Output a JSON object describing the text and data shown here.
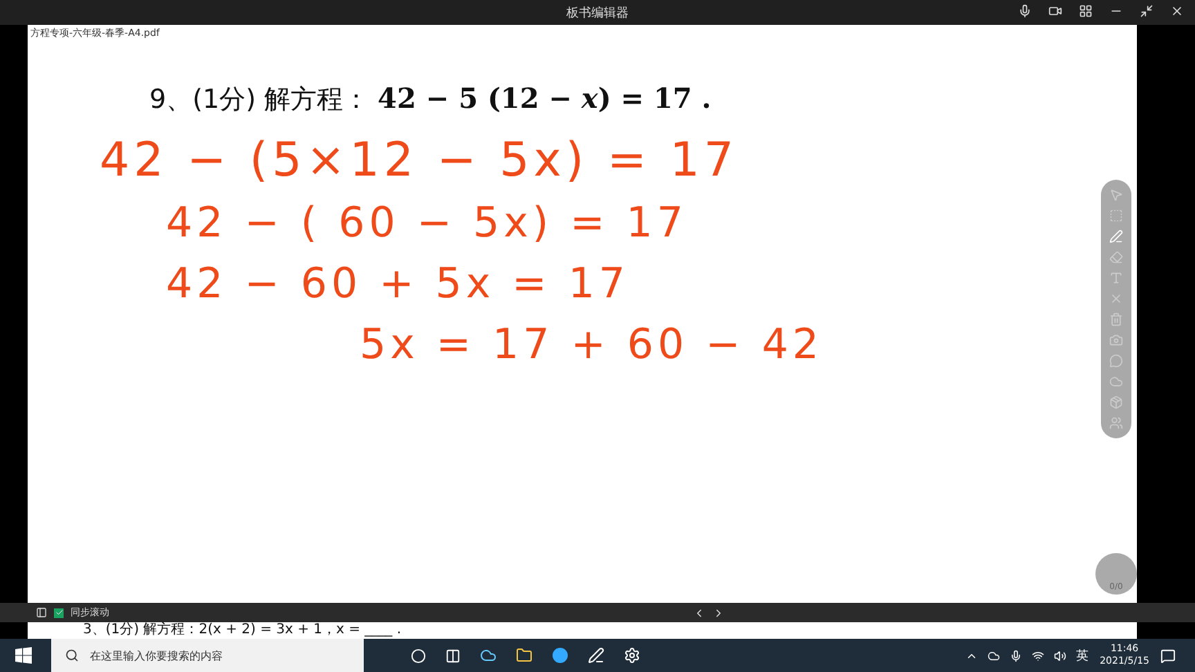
{
  "window": {
    "title": "板书编辑器"
  },
  "document": {
    "filename": "方程专项-六年级-春季-A4.pdf",
    "problem": "9、(1分) 解方程：",
    "equation": "42 − 5 (12 − *x*) = 17 .",
    "handwriting": [
      "42 − (5×12 − 5x) = 17",
      "42 − ( 60 − 5x) = 17",
      "42 − 60 + 5x = 17",
      "5x = 17 + 60 − 42"
    ],
    "next_line": "3、(1分) 解方程：2(x + 2) = 3x + 1，x = ____ ."
  },
  "pen_tools": [
    {
      "kind": "pointer",
      "selected": false
    },
    {
      "kind": "select",
      "selected": false
    },
    {
      "kind": "pen",
      "selected": true
    },
    {
      "kind": "eraser",
      "selected": false
    },
    {
      "kind": "text",
      "selected": false
    },
    {
      "kind": "clear",
      "selected": false
    },
    {
      "kind": "trash",
      "selected": false
    },
    {
      "kind": "camera",
      "selected": false
    },
    {
      "kind": "chat",
      "selected": false
    },
    {
      "kind": "cloud",
      "selected": false
    },
    {
      "kind": "box",
      "selected": false
    },
    {
      "kind": "people",
      "selected": false
    }
  ],
  "page_counter": "0/0",
  "sync_bar": {
    "label": "同步滚动",
    "checked": true
  },
  "taskbar": {
    "search_placeholder": "在这里输入你要搜索的内容",
    "ime": "英",
    "time": "11:46",
    "date": "2021/5/15"
  }
}
